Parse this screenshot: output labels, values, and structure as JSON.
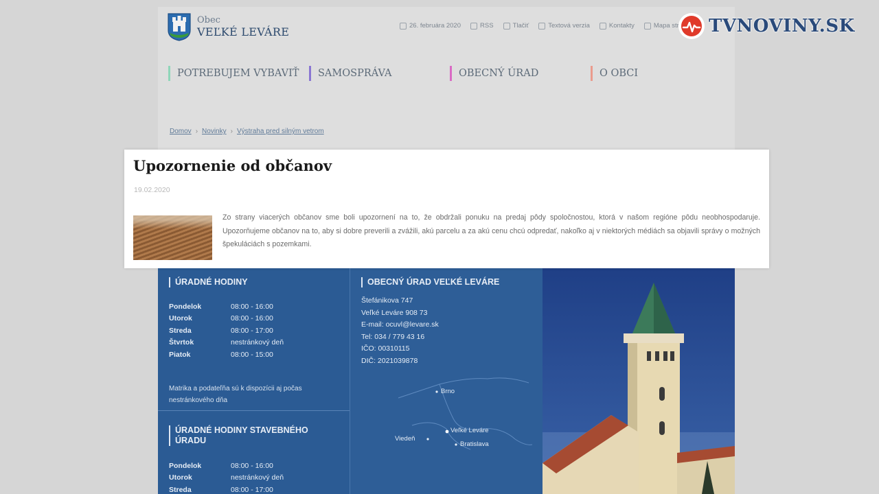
{
  "site": {
    "brand_small": "Obec",
    "brand_big": "VEĽKÉ LEVÁRE",
    "toolbar": [
      {
        "icon": "calendar-icon",
        "label": "26. februára 2020"
      },
      {
        "icon": "rss-icon",
        "label": "RSS"
      },
      {
        "icon": "print-icon",
        "label": "Tlačiť"
      },
      {
        "icon": "text-version-icon",
        "label": "Textová verzia"
      },
      {
        "icon": "location-icon",
        "label": "Kontakty"
      },
      {
        "icon": "sitemap-icon",
        "label": "Mapa stránk"
      }
    ],
    "nav": [
      {
        "label": "POTREBUJEM VYBAVIŤ",
        "color": "#8fd6b9"
      },
      {
        "label": "SAMOSPRÁVA",
        "color": "#8a76d2"
      },
      {
        "label": "OBECNÝ ÚRAD",
        "color": "#d96ac4"
      },
      {
        "label": "O OBCI",
        "color": "#ea9b8d"
      }
    ],
    "breadcrumb": [
      "Domov",
      "Novinky",
      "Výstraha pred silným vetrom"
    ]
  },
  "article": {
    "title": "Upozornenie od občanov",
    "date": "19.02.2020",
    "text": "Zo strany viacerých občanov sme boli upozornení na to, že obdržali ponuku na predaj pôdy spoločnostou, ktorá v našom regióne pôdu neobhospodaruje. Upozorňujeme občanov na to, aby si dobre preverili a zvážili, akú parcelu a za akú cenu chcú odpredať, nakoľko aj v niektorých médiách sa objavili správy o možných špekuláciách s pozemkami."
  },
  "footer": {
    "office_hours": {
      "title": "ÚRADNÉ HODINY",
      "rows": [
        {
          "day": "Pondelok",
          "time": "08:00 - 16:00"
        },
        {
          "day": "Utorok",
          "time": "08:00 - 16:00"
        },
        {
          "day": "Streda",
          "time": "08:00 - 17:00"
        },
        {
          "day": "Štvrtok",
          "time": "nestránkový deň"
        },
        {
          "day": "Piatok",
          "time": "08:00 - 15:00"
        }
      ],
      "note": "Matrika a podateľňa sú k dispozícii aj počas nestránkového dňa"
    },
    "building_hours": {
      "title": "ÚRADNÉ HODINY STAVEBNÉHO ÚRADU",
      "rows": [
        {
          "day": "Pondelok",
          "time": "08:00 - 16:00"
        },
        {
          "day": "Utorok",
          "time": "nestránkový deň"
        },
        {
          "day": "Streda",
          "time": "08:00 - 17:00"
        }
      ]
    },
    "office": {
      "title": "OBECNÝ ÚRAD VEĽKÉ LEVÁRE",
      "lines": [
        "Štefánikova 747",
        "Veľké Leváre 908 73",
        "E-mail: ocuvl@levare.sk",
        "Tel: 034 / 779 43 16",
        "IČO: 00310115",
        "DIČ: 2021039878"
      ],
      "map_labels": {
        "brno": "Brno",
        "vieden": "Viedeň",
        "levare": "Veľké Leváre",
        "bratislava": "Bratislava"
      }
    }
  },
  "watermark": {
    "text": "TVNOVINY.SK",
    "color": "#2a4a7a",
    "accent": "#e03a2a"
  }
}
